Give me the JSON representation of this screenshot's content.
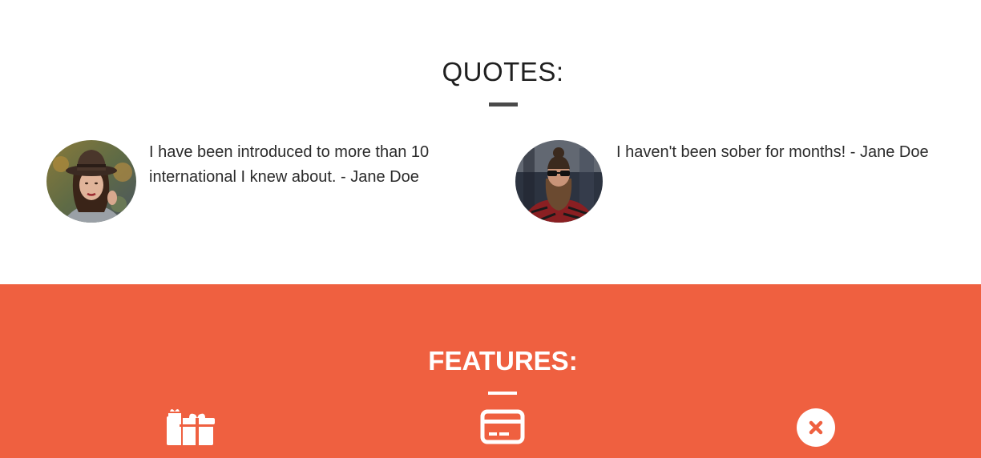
{
  "quotes": {
    "title": "QUOTES:",
    "items": [
      {
        "text": "I have been introduced to more than 10 international I knew about. - Jane Doe",
        "avatar": "woman-in-hat-avatar"
      },
      {
        "text": "I haven't been sober for months! - Jane Doe",
        "avatar": "bearded-man-sunglasses-avatar"
      }
    ]
  },
  "features": {
    "title": "FEATURES:",
    "icons": [
      "gift-icon",
      "credit-card-icon",
      "close-circle-icon"
    ],
    "accent_color": "#ef6040"
  }
}
